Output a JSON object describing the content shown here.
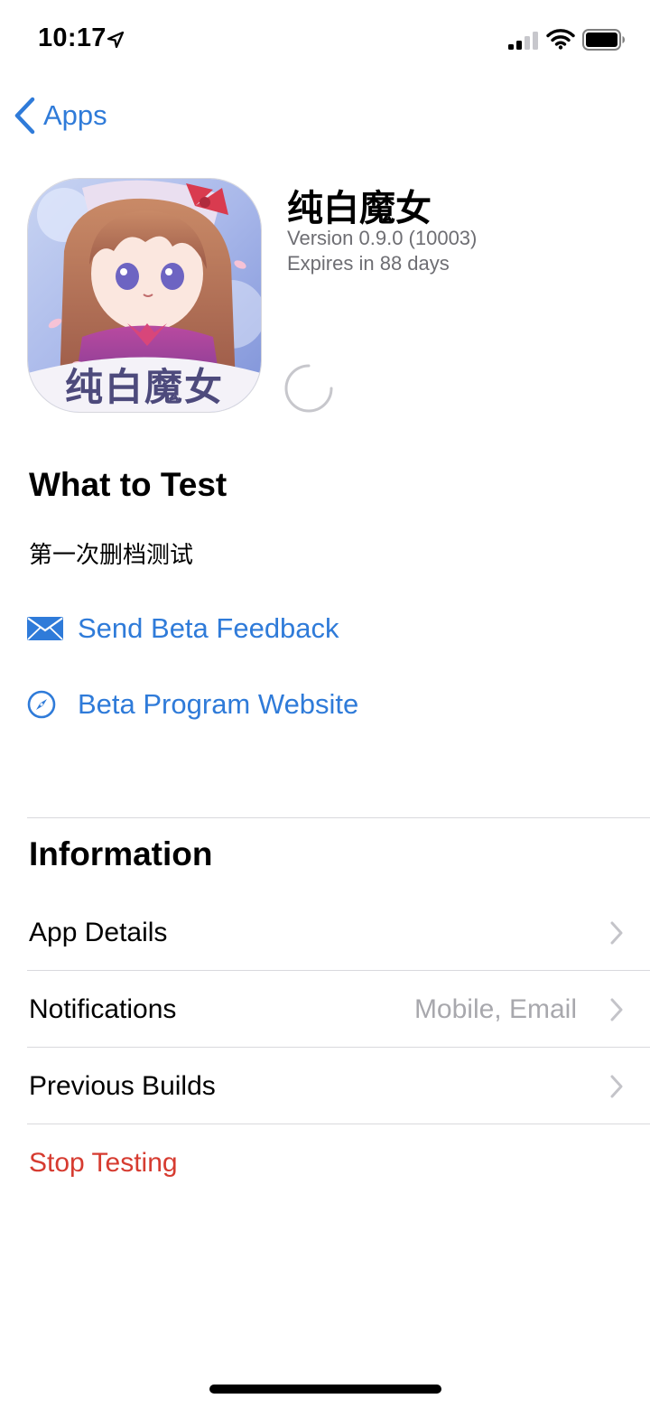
{
  "status_bar": {
    "time": "10:17"
  },
  "nav": {
    "back_label": "Apps"
  },
  "app": {
    "name": "纯白魔女",
    "version": "Version 0.9.0 (10003)",
    "expires": "Expires in 88 days",
    "icon_text": "纯白魔女"
  },
  "what_to_test": {
    "title": "What to Test",
    "notes": "第一次删档测试"
  },
  "links": {
    "feedback": "Send Beta Feedback",
    "website": "Beta Program Website"
  },
  "information": {
    "title": "Information",
    "rows": [
      {
        "label": "App Details",
        "value": ""
      },
      {
        "label": "Notifications",
        "value": "Mobile, Email"
      },
      {
        "label": "Previous Builds",
        "value": ""
      }
    ]
  },
  "stop_testing": "Stop Testing",
  "colors": {
    "accent": "#2f7bd9",
    "destructive": "#d63b30",
    "secondary": "#6e6e73"
  }
}
